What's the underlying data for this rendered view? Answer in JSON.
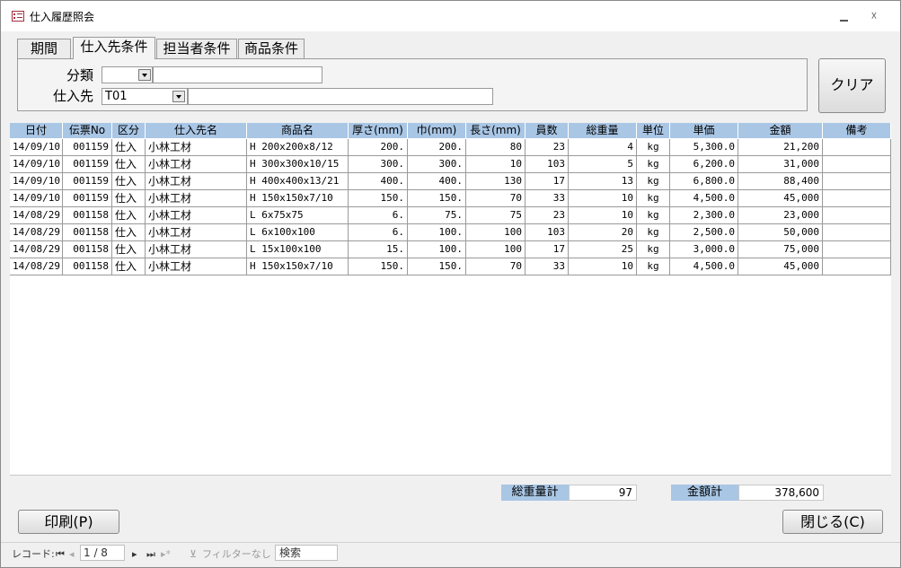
{
  "window": {
    "title": "仕入履歴照会",
    "minimize_icon": "minimize-icon",
    "close_glyph": "☓"
  },
  "tabs": [
    {
      "label": "期間"
    },
    {
      "label": "仕入先条件"
    },
    {
      "label": "担当者条件"
    },
    {
      "label": "商品条件"
    }
  ],
  "filter": {
    "category_label": "分類",
    "category_value": "",
    "supplier_label": "仕入先",
    "supplier_value": "T01",
    "supplier_name": ""
  },
  "buttons": {
    "clear": "クリア",
    "print": "印刷(P)",
    "close": "閉じる(C)"
  },
  "grid": {
    "columns": [
      "日付",
      "伝票No",
      "区分",
      "仕入先名",
      "商品名",
      "厚さ(mm)",
      "巾(mm)",
      "長さ(mm)",
      "員数",
      "総重量",
      "単位",
      "単価",
      "金額",
      "備考"
    ],
    "rows": [
      [
        "14/09/10",
        "001159",
        "仕入",
        "小林工材",
        "H  200x200x8/12",
        "200.",
        "200.",
        "80",
        "23",
        "4",
        "kg",
        "5,300.0",
        "21,200",
        ""
      ],
      [
        "14/09/10",
        "001159",
        "仕入",
        "小林工材",
        "H  300x300x10/15",
        "300.",
        "300.",
        "10",
        "103",
        "5",
        "kg",
        "6,200.0",
        "31,000",
        ""
      ],
      [
        "14/09/10",
        "001159",
        "仕入",
        "小林工材",
        "H  400x400x13/21",
        "400.",
        "400.",
        "130",
        "17",
        "13",
        "kg",
        "6,800.0",
        "88,400",
        ""
      ],
      [
        "14/09/10",
        "001159",
        "仕入",
        "小林工材",
        "H  150x150x7/10",
        "150.",
        "150.",
        "70",
        "33",
        "10",
        "kg",
        "4,500.0",
        "45,000",
        ""
      ],
      [
        "14/08/29",
        "001158",
        "仕入",
        "小林工材",
        "L  6x75x75",
        "6.",
        "75.",
        "75",
        "23",
        "10",
        "kg",
        "2,300.0",
        "23,000",
        ""
      ],
      [
        "14/08/29",
        "001158",
        "仕入",
        "小林工材",
        "L  6x100x100",
        "6.",
        "100.",
        "100",
        "103",
        "20",
        "kg",
        "2,500.0",
        "50,000",
        ""
      ],
      [
        "14/08/29",
        "001158",
        "仕入",
        "小林工材",
        "L  15x100x100",
        "15.",
        "100.",
        "100",
        "17",
        "25",
        "kg",
        "3,000.0",
        "75,000",
        ""
      ],
      [
        "14/08/29",
        "001158",
        "仕入",
        "小林工材",
        "H  150x150x7/10",
        "150.",
        "150.",
        "70",
        "33",
        "10",
        "kg",
        "4,500.0",
        "45,000",
        ""
      ]
    ]
  },
  "totals": {
    "weight_label": "総重量計",
    "weight_value": "97",
    "amount_label": "金額計",
    "amount_value": "378,600"
  },
  "status": {
    "record_label": "レコード:",
    "first_glyph": "⏮",
    "prev_glyph": "◂",
    "record_position": "1 / 8",
    "next_glyph": "▸",
    "last_glyph": "⏭",
    "new_glyph": "▸*",
    "filter_icon_glyph": "⊻",
    "filter_text": "フィルターなし",
    "search_text": "検索"
  }
}
